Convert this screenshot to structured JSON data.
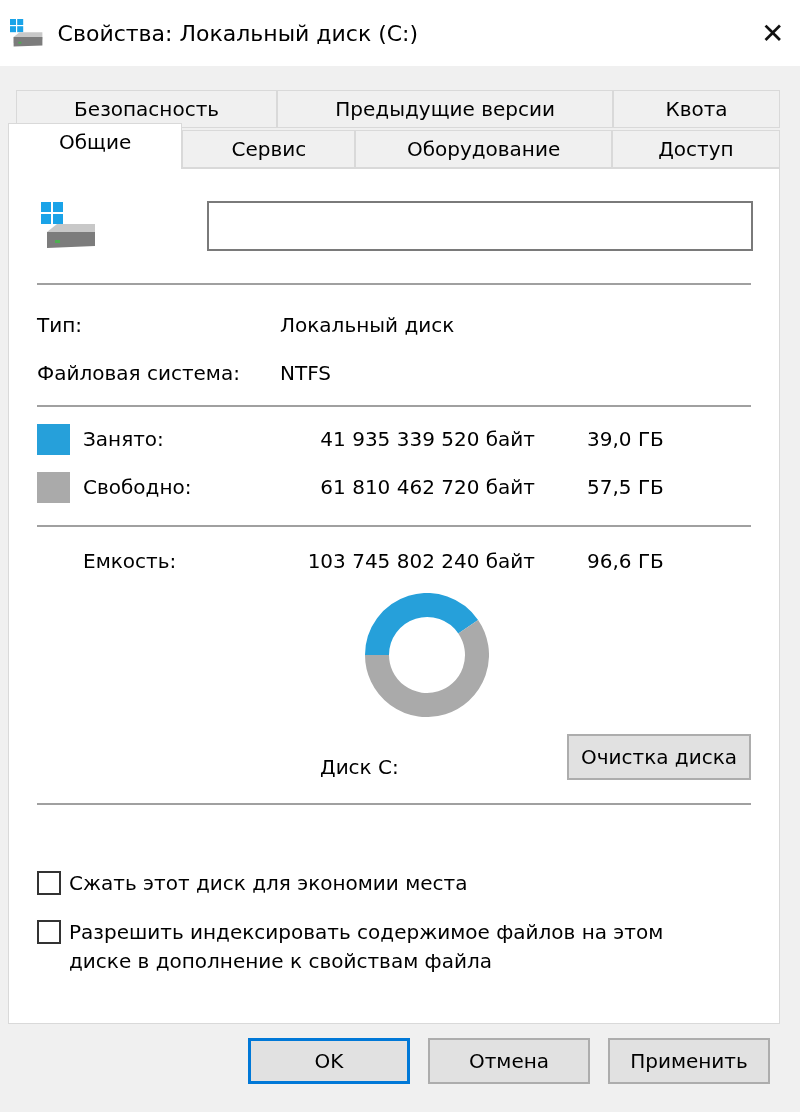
{
  "window": {
    "title": "Свойства: Локальный диск (C:)",
    "close": "✕"
  },
  "tab_rows": [
    [
      {
        "label": "Безопасность",
        "selected": false
      },
      {
        "label": "Предыдущие версии",
        "selected": false
      },
      {
        "label": "Квота",
        "selected": false
      }
    ],
    [
      {
        "label": "Общие",
        "selected": true
      },
      {
        "label": "Сервис",
        "selected": false
      },
      {
        "label": "Оборудование",
        "selected": false
      },
      {
        "label": "Доступ",
        "selected": false
      }
    ]
  ],
  "info": [
    {
      "label": "Тип:",
      "value": "Локальный диск"
    },
    {
      "label": "Файловая система:",
      "value": "NTFS"
    }
  ],
  "usage": [
    {
      "label": "Занято:",
      "bytes": "41 935 339 520 байт",
      "size": "39,0 ГБ",
      "color": "#26a0da"
    },
    {
      "label": "Свободно:",
      "bytes": "61 810 462 720 байт",
      "size": "57,5 ГБ",
      "color": "#aaaaaa"
    }
  ],
  "capacity": {
    "label": "Емкость:",
    "bytes": "103 745 802 240 байт",
    "size": "96,6 ГБ"
  },
  "drive_label": "Диск C:",
  "cleanup_button": "Очистка диска",
  "options": [
    {
      "label": "Сжать этот диск для экономии места",
      "checked": false
    },
    {
      "label": "Разрешить индексировать содержимое файлов на этом диске в дополнение к свойствам файла",
      "checked": false
    }
  ],
  "buttons": [
    {
      "label": "OK",
      "default": true
    },
    {
      "label": "Отмена",
      "default": false
    },
    {
      "label": "Применить",
      "default": false
    }
  ]
}
